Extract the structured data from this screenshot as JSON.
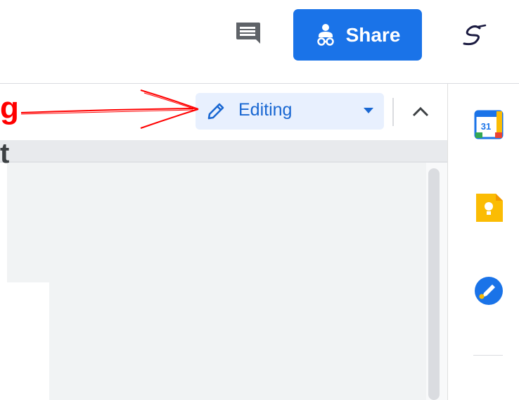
{
  "header": {
    "comment_icon": "comment-icon",
    "share_label": "Share",
    "share_icon": "people-lock-icon",
    "avatar_icon": "signature-avatar-icon"
  },
  "toolbar": {
    "mode": {
      "label": "Editing",
      "icon": "pencil-icon",
      "dropdown_icon": "caret-down-icon"
    },
    "collapse_icon": "chevron-up-icon"
  },
  "side_panel": {
    "items": [
      {
        "name": "calendar",
        "icon": "google-calendar-icon",
        "text": "31"
      },
      {
        "name": "keep",
        "icon": "google-keep-icon"
      },
      {
        "name": "tasks",
        "icon": "google-tasks-icon"
      }
    ]
  },
  "annotation": {
    "highlight_text": "g",
    "secondary_text": "t",
    "arrow_color": "#ff0000"
  },
  "colors": {
    "accent": "#1a73e8",
    "mode_bg": "#e8f0fe",
    "mode_text": "#1967d2",
    "annotation": "#ff0000"
  }
}
